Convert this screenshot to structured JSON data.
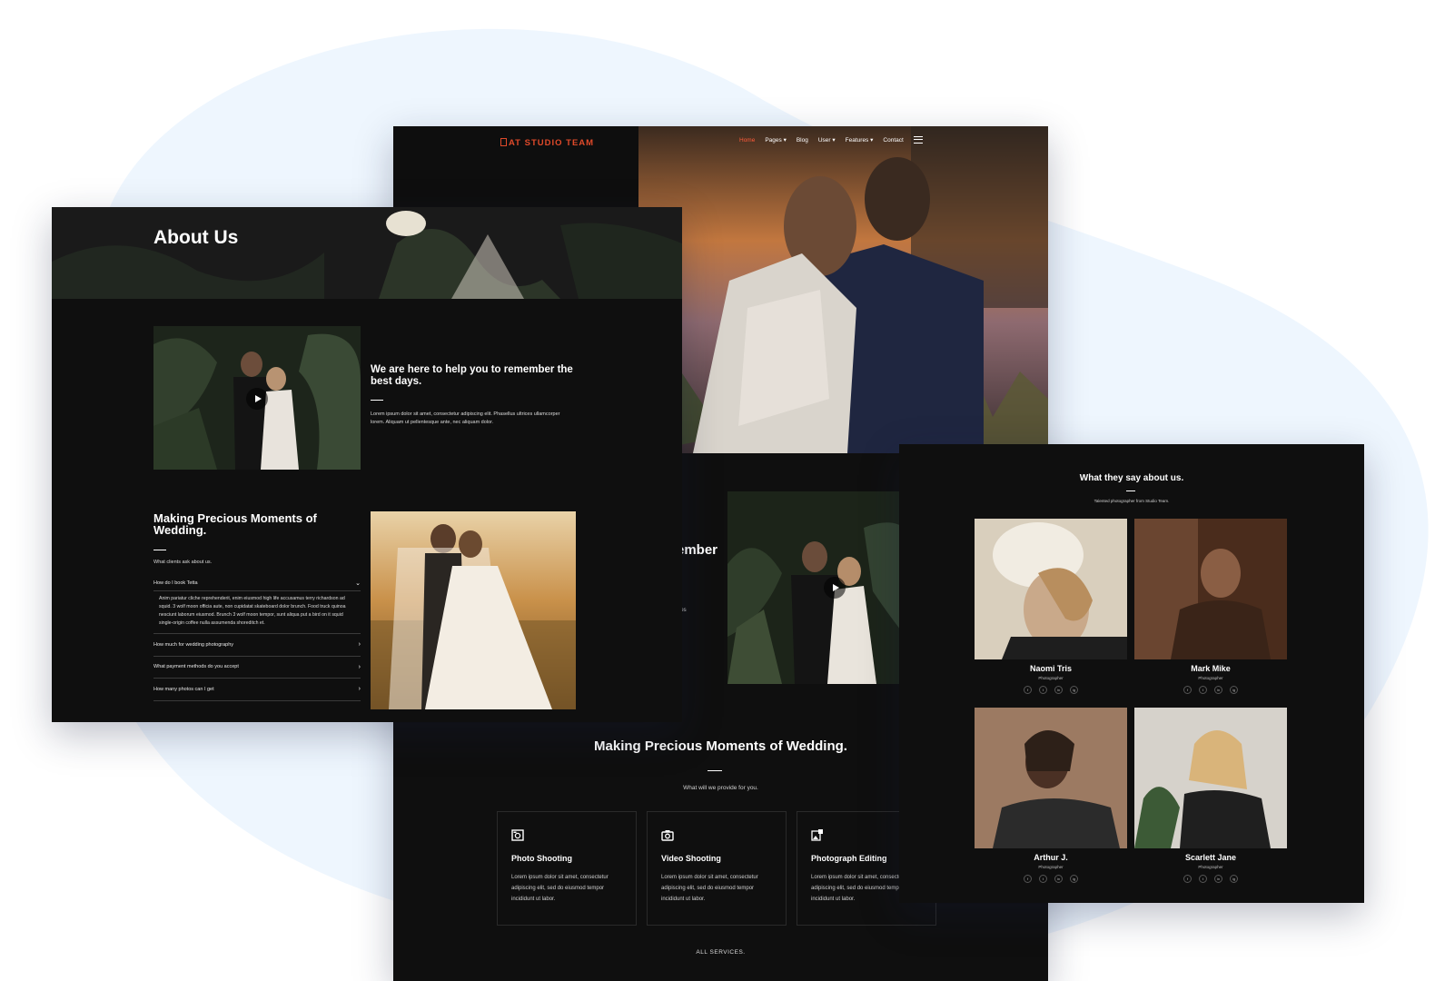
{
  "main": {
    "logo": {
      "prefix": "AT",
      "name": "STUDIO TEAM"
    },
    "nav": [
      {
        "label": "Home"
      },
      {
        "label": "Pages ▾"
      },
      {
        "label": "Blog"
      },
      {
        "label": "User ▾"
      },
      {
        "label": "Features ▾"
      },
      {
        "label": "Contact"
      }
    ],
    "partial_heading": "ember",
    "partial_small": "ices",
    "services": {
      "title": "Making Precious Moments of Wedding.",
      "subtitle": "What will we provide for you.",
      "cards": [
        {
          "icon": "photo-camera-icon",
          "title": "Photo Shooting",
          "text": "Lorem ipsum dolor sit amet, consectetur adipiscing elit, sed do eiusmod tempor incididunt ut labor."
        },
        {
          "icon": "camera-icon",
          "title": "Video Shooting",
          "text": "Lorem ipsum dolor sit amet, consectetur adipiscing elit, sed do eiusmod tempor incididunt ut labor."
        },
        {
          "icon": "image-edit-icon",
          "title": "Photograph Editing",
          "text": "Lorem ipsum dolor sit amet, consectetur adipiscing elit, sed do eiusmod tempor incididunt ut labor."
        }
      ],
      "all_link": "ALL SERVICES."
    }
  },
  "about": {
    "title": "About Us",
    "help_title": "We are here to help you to remember the best days.",
    "help_text": "Lorem ipsum dolor sit amet, consectetur adipiscing elit. Phasellus ultrices ullamcorper lorem. Aliquam ut pellentesque ante, nec aliquam dolor.",
    "moments_title": "Making Precious Moments of Wedding.",
    "moments_sub": "What clients ask about us.",
    "faq": [
      {
        "q": "How do I book Tetta",
        "a": "Anim pariatur cliche reprehenderit, enim eiusmod high life accusamus terry richardson ad squid. 3 wolf moon officia aute, non cupidatat skateboard dolor brunch. Food truck quinoa nesciunt laborum eiusmod. Brunch 3 wolf moon tempor, sunt aliqua put a bird on it squid single-origin coffee nulla assumenda shoreditch et."
      },
      {
        "q": "How much for wedding photography"
      },
      {
        "q": "What payment methods do you accept"
      },
      {
        "q": "How many photos can I get"
      }
    ]
  },
  "team": {
    "title": "What they say about us.",
    "subtitle": "Talented photographer from Studio Team.",
    "members": [
      {
        "name": "Naomi Tris",
        "role": "Photographer"
      },
      {
        "name": "Mark Mike",
        "role": "Photographer"
      },
      {
        "name": "Arthur J.",
        "role": "Photographer"
      },
      {
        "name": "Scarlett Jane",
        "role": "Photographer"
      }
    ],
    "social_icons": [
      "f",
      "t",
      "in",
      "ig"
    ]
  },
  "colors": {
    "accent": "#ff5b3a",
    "panel_bg": "#0f0f0f",
    "backdrop": "#eef6fe"
  }
}
